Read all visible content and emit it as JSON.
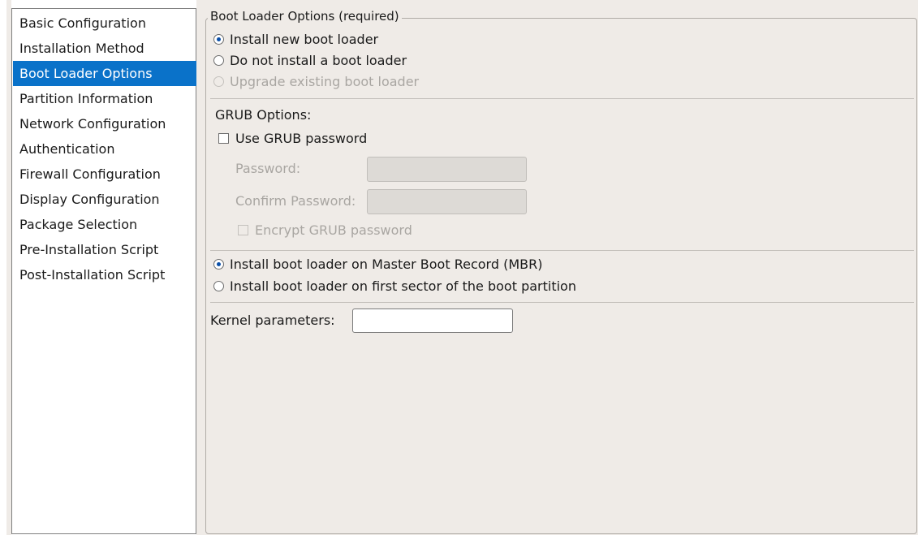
{
  "sidebar": {
    "items": [
      {
        "label": "Basic Configuration"
      },
      {
        "label": "Installation Method"
      },
      {
        "label": "Boot Loader Options"
      },
      {
        "label": "Partition Information"
      },
      {
        "label": "Network Configuration"
      },
      {
        "label": "Authentication"
      },
      {
        "label": "Firewall Configuration"
      },
      {
        "label": "Display Configuration"
      },
      {
        "label": "Package Selection"
      },
      {
        "label": "Pre-Installation Script"
      },
      {
        "label": "Post-Installation Script"
      }
    ],
    "selected": "Boot Loader Options"
  },
  "boot_loader": {
    "title": "Boot Loader Options (required)",
    "install_options": [
      {
        "label": "Install new boot loader",
        "checked": true,
        "enabled": true
      },
      {
        "label": "Do not install a boot loader",
        "checked": false,
        "enabled": true
      },
      {
        "label": "Upgrade existing boot loader",
        "checked": false,
        "enabled": false
      }
    ]
  },
  "grub": {
    "title": "GRUB Options:",
    "use_password_label": "Use GRUB password",
    "use_password_checked": false,
    "password_label": "Password:",
    "password_value": "",
    "confirm_label": "Confirm Password:",
    "confirm_value": "",
    "encrypt_label": "Encrypt GRUB password",
    "encrypt_checked": false
  },
  "location": {
    "options": [
      {
        "label": "Install boot loader on Master Boot Record (MBR)",
        "checked": true
      },
      {
        "label": "Install boot loader on first sector of the boot partition",
        "checked": false
      }
    ]
  },
  "kernel": {
    "label": "Kernel parameters:",
    "value": ""
  },
  "colors": {
    "selection": "#0a72c9",
    "background": "#efebe7",
    "disabled_text": "#a9a6a2"
  }
}
